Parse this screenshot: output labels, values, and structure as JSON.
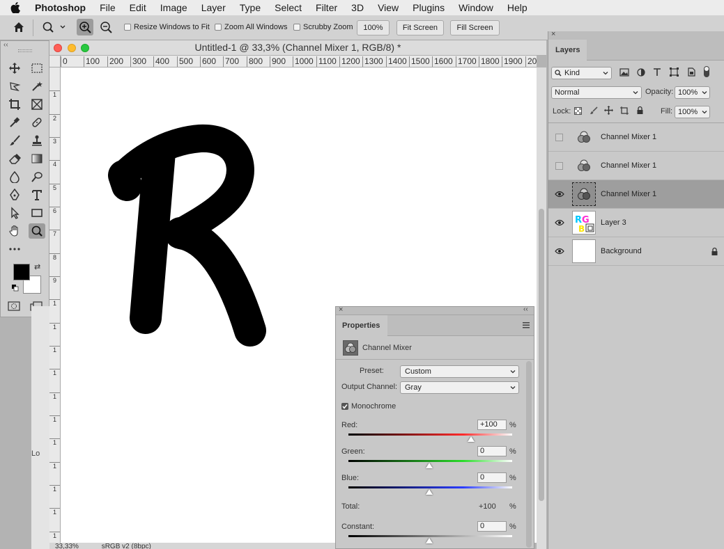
{
  "menubar": {
    "app_name": "Photoshop",
    "items": [
      "File",
      "Edit",
      "Image",
      "Layer",
      "Type",
      "Select",
      "Filter",
      "3D",
      "View",
      "Plugins",
      "Window",
      "Help"
    ]
  },
  "options_bar": {
    "resize_windows": "Resize Windows to Fit",
    "zoom_all": "Zoom All Windows",
    "scrubby": "Scrubby Zoom",
    "zoom_100": "100%",
    "fit_screen": "Fit Screen",
    "fill_screen": "Fill Screen"
  },
  "document": {
    "title": "Untitled-1 @ 33,3% (Channel Mixer 1, RGB/8) *",
    "ruler_top": [
      "0",
      "100",
      "200",
      "300",
      "400",
      "500",
      "600",
      "700",
      "800",
      "900",
      "1000",
      "1100",
      "1200",
      "1300",
      "1400",
      "1500",
      "1600",
      "1700",
      "1800",
      "1900",
      "20"
    ],
    "ruler_left": [
      "1",
      "2",
      "3",
      "4",
      "5",
      "6",
      "7",
      "8",
      "9",
      "1",
      "1",
      "1",
      "1",
      "1",
      "1",
      "1",
      "1",
      "1",
      "1",
      "1",
      "2",
      "1",
      "1"
    ],
    "status_zoom": "33,33%",
    "status_profile": "sRGB v2 (8bpc)",
    "canvas_letter": "R"
  },
  "properties": {
    "tab": "Properties",
    "adjustment": "Channel Mixer",
    "preset_label": "Preset:",
    "preset_value": "Custom",
    "output_label": "Output Channel:",
    "output_value": "Gray",
    "monochrome_label": "Monochrome",
    "monochrome_checked": true,
    "red_label": "Red:",
    "red_value": "+100",
    "green_label": "Green:",
    "green_value": "0",
    "blue_label": "Blue:",
    "blue_value": "0",
    "total_label": "Total:",
    "total_value": "+100",
    "constant_label": "Constant:",
    "constant_value": "0",
    "pct": "%"
  },
  "layers_panel": {
    "tab": "Layers",
    "kind_label": "Kind",
    "blend_mode": "Normal",
    "opacity_label": "Opacity:",
    "opacity_value": "100%",
    "lock_label": "Lock:",
    "fill_label": "Fill:",
    "fill_value": "100%",
    "layers": [
      {
        "name": "Channel Mixer 1",
        "visible": false
      },
      {
        "name": "Channel Mixer 1",
        "visible": false
      },
      {
        "name": "Channel Mixer 1",
        "visible": true
      },
      {
        "name": "Layer 3",
        "visible": true
      },
      {
        "name": "Background",
        "visible": true
      }
    ]
  },
  "colors": {
    "accent_selected_layer": "#9e9e9e",
    "foreground": "#000000",
    "background": "#ffffff"
  }
}
